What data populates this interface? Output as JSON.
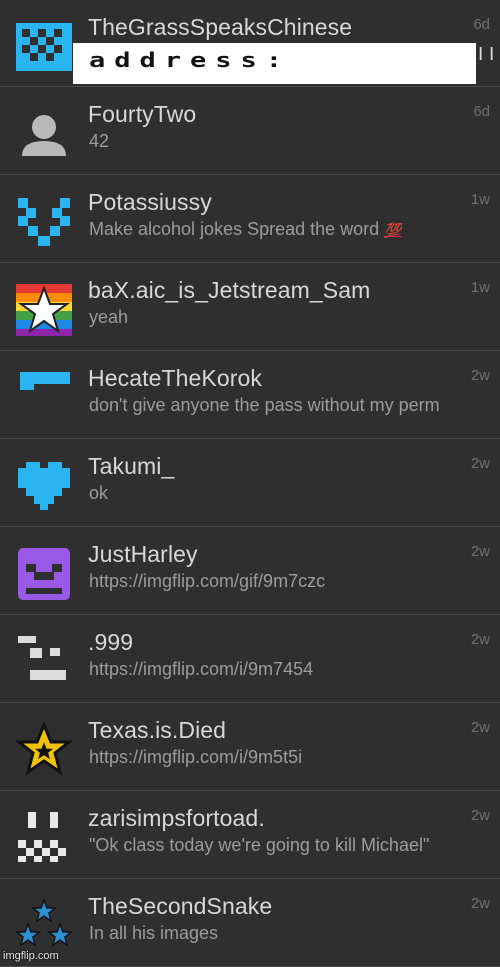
{
  "conversations": [
    {
      "name": "TheGrassSpeaksChinese",
      "message": "",
      "time": "6d",
      "avatar_icon": "blue-checker-icon"
    },
    {
      "name": "FourtyTwo",
      "message": "42",
      "time": "6d",
      "avatar_icon": "default-user-icon"
    },
    {
      "name": "Potassiussy",
      "message": "Make alcohol jokes Spread the word",
      "message_emoji": "💯",
      "time": "1w",
      "avatar_icon": "blue-pixel-heart-outline-icon"
    },
    {
      "name": "baX.aic_is_Jetstream_Sam",
      "message": "yeah",
      "time": "1w",
      "avatar_icon": "rainbow-star-icon"
    },
    {
      "name": "HecateTheKorok",
      "message": "don't give anyone the pass without my perm",
      "time": "2w",
      "avatar_icon": "blue-bar-icon"
    },
    {
      "name": "Takumi_",
      "message": "ok",
      "time": "2w",
      "avatar_icon": "blue-pixel-heart-icon"
    },
    {
      "name": "JustHarley",
      "message": "https://imgflip.com/gif/9m7czc",
      "time": "2w",
      "avatar_icon": "purple-pixel-face-icon"
    },
    {
      "name": ".999",
      "message": "https://imgflip.com/i/9m7454",
      "time": "2w",
      "avatar_icon": "white-pixel-glyph-icon"
    },
    {
      "name": "Texas.is.Died",
      "message": "https://imgflip.com/i/9m5t5i",
      "time": "2w",
      "avatar_icon": "gold-star-icon"
    },
    {
      "name": "zarisimpsfortoad.",
      "message": "\"Ok class today we're going to kill Michael\"",
      "time": "2w",
      "avatar_icon": "white-pixel-pattern-icon"
    },
    {
      "name": "TheSecondSnake",
      "message": "In all his images",
      "time": "2w",
      "avatar_icon": "blue-star-cluster-icon"
    }
  ],
  "overlay": {
    "text": "address:",
    "edge_text": "I I"
  },
  "watermark": "imgflip.com",
  "colors": {
    "background": "#2f2f2f",
    "divider": "#4a4a4a",
    "accent_blue": "#2bb5f0",
    "purple": "#9b59e8"
  }
}
